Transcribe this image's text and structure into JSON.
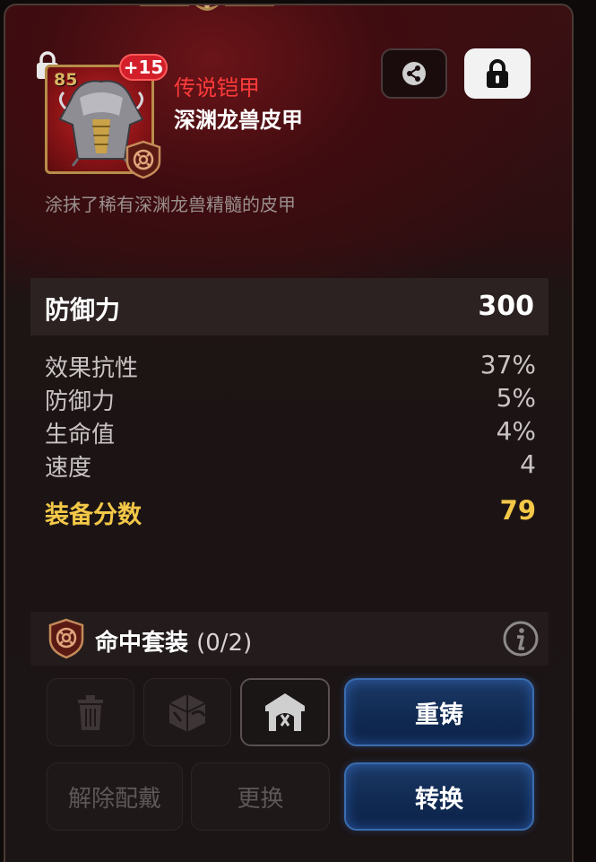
{
  "item": {
    "level": "85",
    "enhance": "+15",
    "rarity": "传说铠甲",
    "name": "深渊龙兽皮甲",
    "description": "涂抹了稀有深渊龙兽精髓的皮甲"
  },
  "main_stat": {
    "label": "防御力",
    "value": "300"
  },
  "sub_stats": [
    {
      "label": "效果抗性",
      "value": "37%"
    },
    {
      "label": "防御力",
      "value": "5%"
    },
    {
      "label": "生命值",
      "value": "4%"
    },
    {
      "label": "速度",
      "value": "4"
    }
  ],
  "score": {
    "label": "装备分数",
    "value": "79"
  },
  "set": {
    "name": "命中套装",
    "count": "(0/2)"
  },
  "buttons": {
    "reforge": "重铸",
    "unequip": "解除配戴",
    "replace": "更换",
    "convert": "转换"
  },
  "icons": {
    "lock": "lock-icon",
    "share": "share-icon",
    "trash": "trash-icon",
    "dice": "dice-icon",
    "forge": "forge-icon",
    "info": "info-icon",
    "hit_set": "hit-set-icon"
  },
  "colors": {
    "rarity": "#ff3b3b",
    "score": "#f3c848",
    "accent_blue": "#1c3a66",
    "frame_gold": "#b78d49"
  }
}
